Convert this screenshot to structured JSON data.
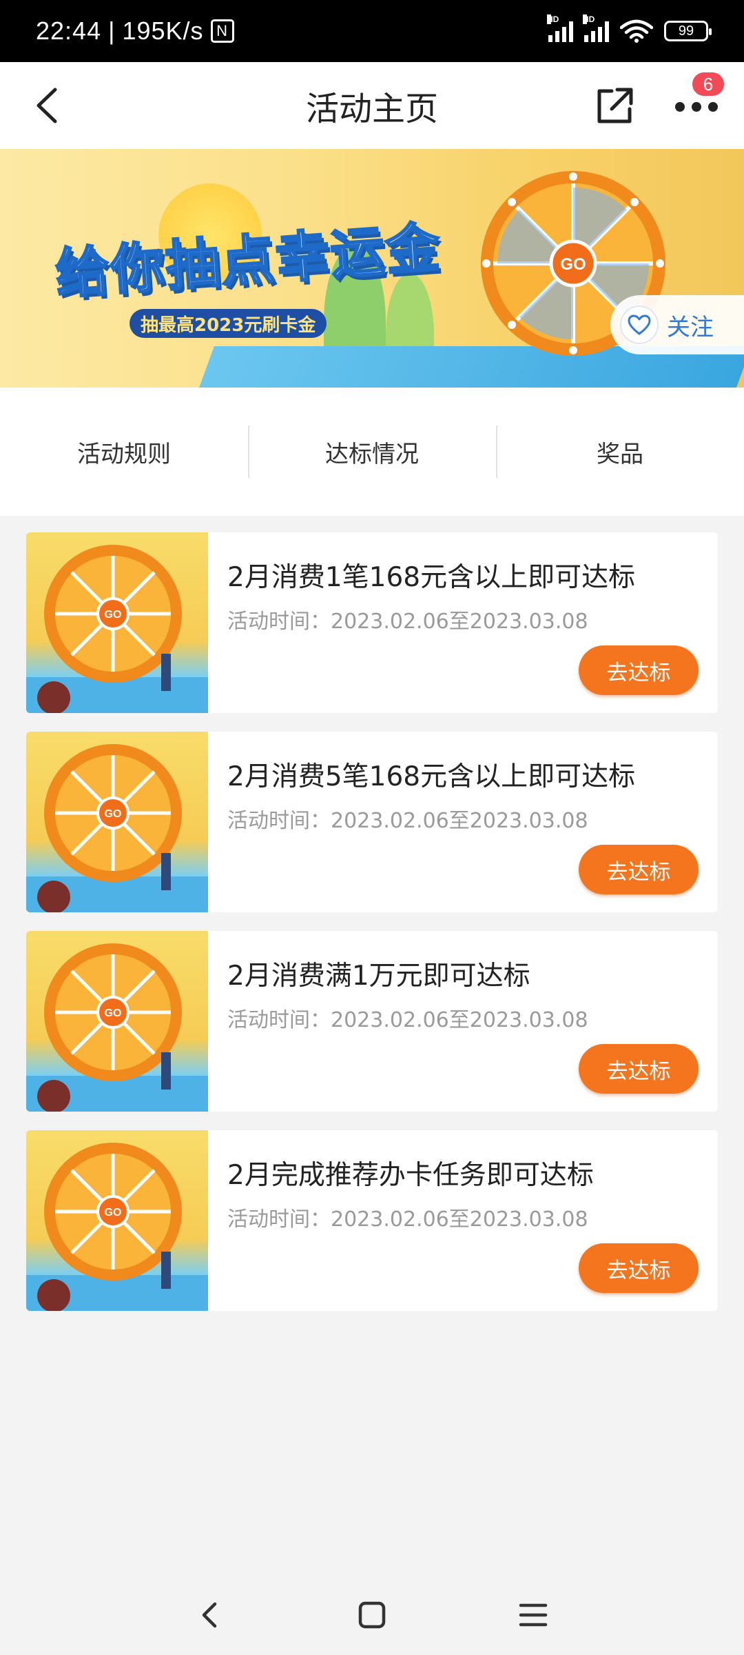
{
  "status_bar": {
    "time": "22:44",
    "net_speed": "195K/s",
    "nfc": "N",
    "signal1_label": "HD",
    "signal2_label": "HD",
    "battery": "99"
  },
  "nav": {
    "title": "活动主页",
    "more_badge": "6"
  },
  "banner": {
    "title": "给你抽点幸运金",
    "subtitle": "抽最高2023元刷卡金",
    "follow_label": "关注"
  },
  "tabs": [
    {
      "label": "活动规则"
    },
    {
      "label": "达标情况"
    },
    {
      "label": "奖品"
    }
  ],
  "tasks": [
    {
      "title": "2月消费1笔168元含以上即可达标",
      "time": "活动时间：2023.02.06至2023.03.08",
      "button": "去达标"
    },
    {
      "title": "2月消费5笔168元含以上即可达标",
      "time": "活动时间：2023.02.06至2023.03.08",
      "button": "去达标"
    },
    {
      "title": "2月消费满1万元即可达标",
      "time": "活动时间：2023.02.06至2023.03.08",
      "button": "去达标"
    },
    {
      "title": "2月完成推荐办卡任务即可达标",
      "time": "活动时间：2023.02.06至2023.03.08",
      "button": "去达标"
    }
  ],
  "icons": {
    "back": "chevron-left-icon",
    "share": "share-external-icon",
    "more": "more-dots-icon",
    "follow": "heart-outline-icon",
    "sys_back": "sys-back-icon",
    "sys_home": "sys-home-icon",
    "sys_menu": "sys-menu-icon"
  },
  "colors": {
    "accent": "#f5751e",
    "badge": "#f24a56",
    "follow_blue": "#2f79d9"
  }
}
